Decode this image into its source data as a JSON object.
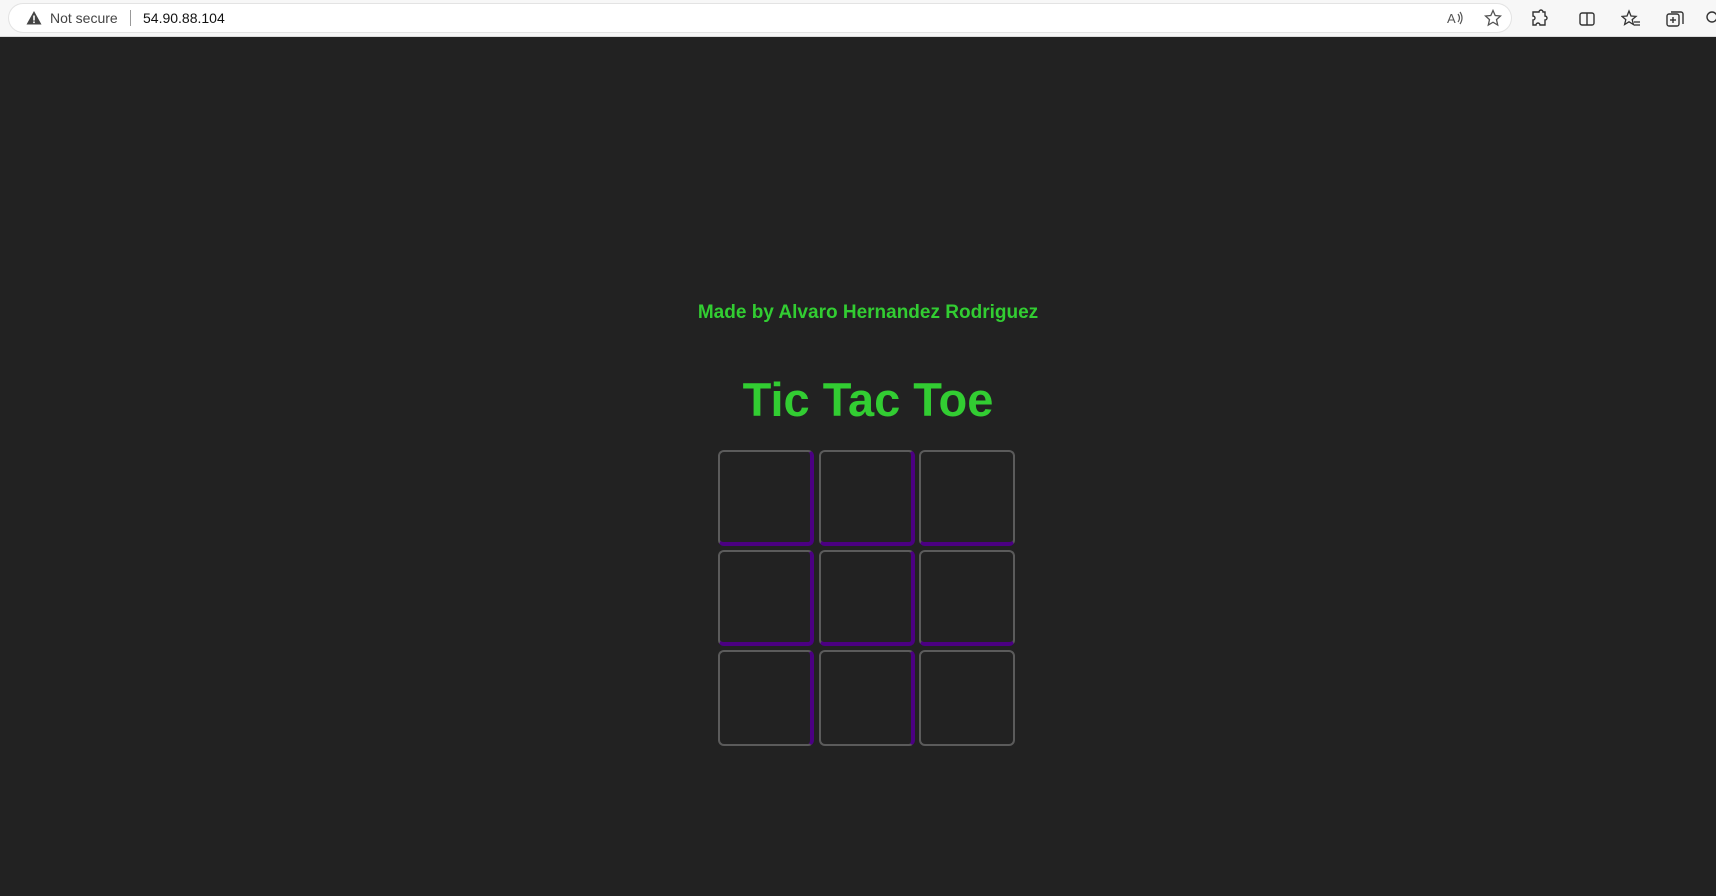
{
  "browser": {
    "security_label": "Not secure",
    "url": "54.90.88.104"
  },
  "page": {
    "credit": "Made by Alvaro Hernandez Rodriguez",
    "title": "Tic Tac Toe",
    "board": [
      "",
      "",
      "",
      "",
      "",
      "",
      "",
      "",
      ""
    ]
  },
  "colors": {
    "text_accent": "#32cd32",
    "grid_line": "#4b0082",
    "background": "#222222",
    "cell_border": "#5b5b5b"
  }
}
